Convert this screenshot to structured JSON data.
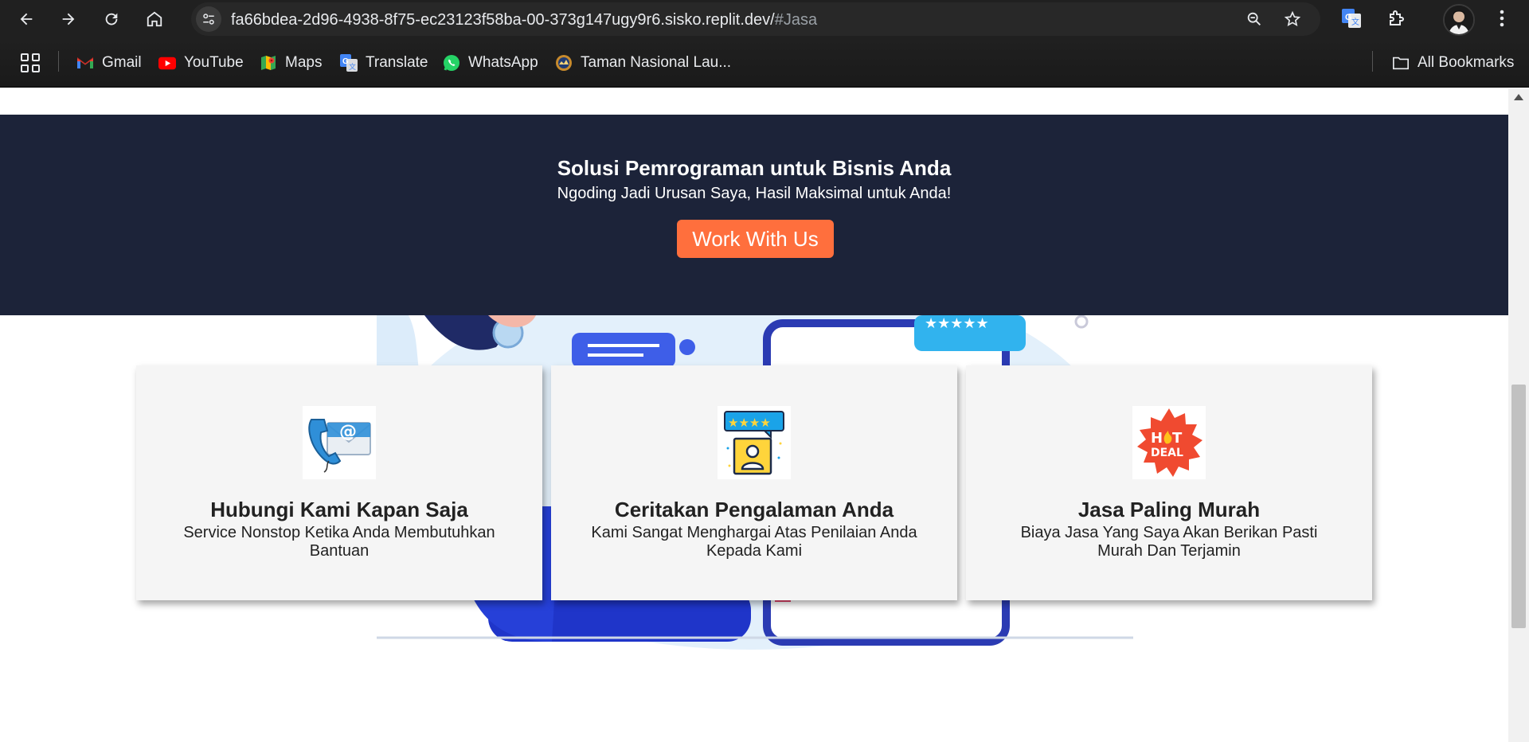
{
  "browser": {
    "url_main": "fa66bdea-2d96-4938-8f75-ec23123f58ba-00-373g147ugy9r6.sisko.replit.dev/",
    "url_fragment": "#Jasa",
    "bookmarks": [
      {
        "label": "Gmail",
        "icon": "gmail-icon"
      },
      {
        "label": "YouTube",
        "icon": "youtube-icon"
      },
      {
        "label": "Maps",
        "icon": "maps-icon"
      },
      {
        "label": "Translate",
        "icon": "translate-icon"
      },
      {
        "label": "WhatsApp",
        "icon": "whatsapp-icon"
      },
      {
        "label": "Taman Nasional Lau...",
        "icon": "park-icon"
      }
    ],
    "all_bookmarks": "All Bookmarks"
  },
  "hero": {
    "title": "Solusi Pemrograman untuk Bisnis Anda",
    "subtitle": "Ngoding Jadi Urusan Saya, Hasil Maksimal untuk Anda!",
    "cta": "Work With Us"
  },
  "cards": [
    {
      "title": "Hubungi Kami Kapan Saja",
      "desc": "Service Nonstop Ketika Anda Membutuhkan Bantuan",
      "icon": "contact-icon"
    },
    {
      "title": "Ceritakan Pengalaman Anda",
      "desc": "Kami Sangat Menghargai Atas Penilaian Anda Kepada Kami",
      "icon": "review-icon"
    },
    {
      "title": "Jasa Paling Murah",
      "desc": "Biaya Jasa Yang Saya Akan Berikan Pasti Murah Dan Terjamin",
      "icon": "hot-deal-icon",
      "badge_text": "HOT DEAL"
    }
  ],
  "colors": {
    "hero_bg": "#1c2339",
    "cta_bg": "#ff6f3d",
    "card_bg": "#f5f5f5"
  }
}
